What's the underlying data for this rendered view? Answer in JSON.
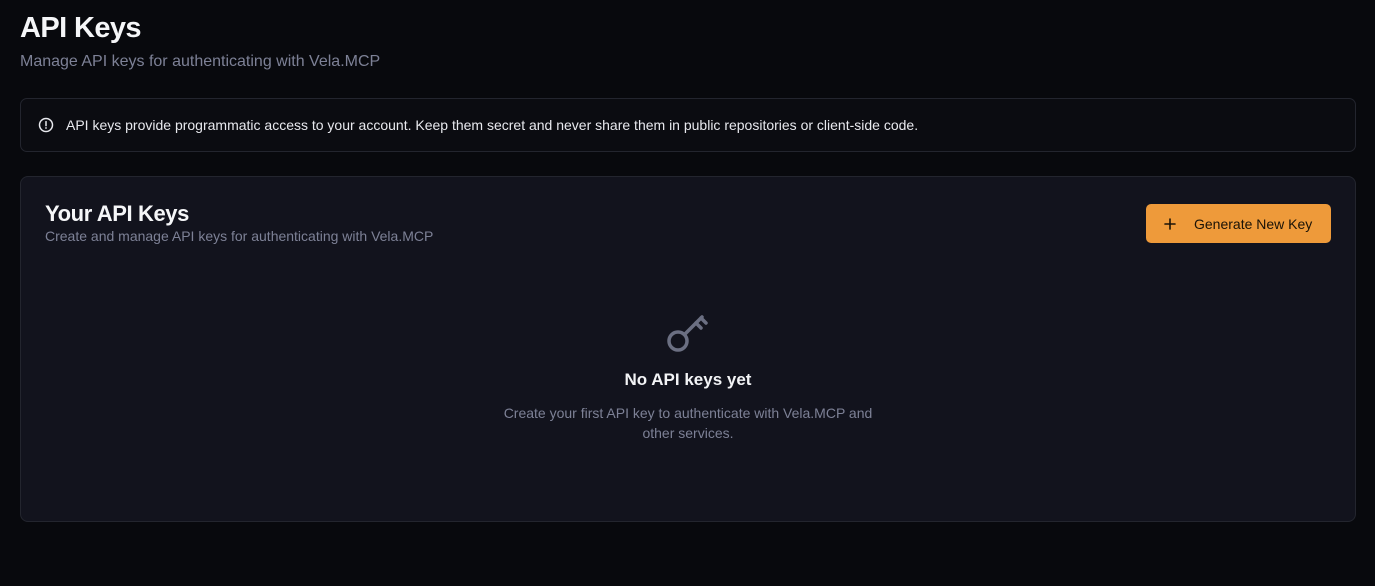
{
  "header": {
    "title": "API Keys",
    "subtitle": "Manage API keys for authenticating with Vela.MCP"
  },
  "notice": {
    "icon": "alert-circle-icon",
    "text": "API keys provide programmatic access to your account. Keep them secret and never share them in public repositories or client-side code."
  },
  "card": {
    "title": "Your API Keys",
    "subtitle": "Create and manage API keys for authenticating with Vela.MCP",
    "generate_button": {
      "icon": "plus-icon",
      "label": "Generate New Key"
    },
    "empty_state": {
      "icon": "key-icon",
      "title": "No API keys yet",
      "description": "Create your first API key to authenticate with Vela.MCP and other services."
    }
  },
  "colors": {
    "background": "#08090d",
    "card_background": "#12131d",
    "border": "#23252e",
    "accent": "#ee9a3a",
    "muted_text": "#7d8196"
  }
}
